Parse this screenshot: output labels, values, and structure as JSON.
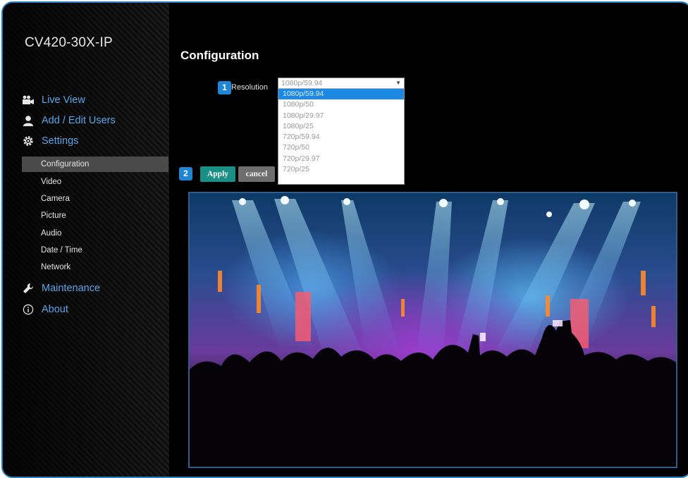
{
  "device": {
    "title": "CV420-30X-IP"
  },
  "nav": {
    "main": [
      {
        "label": "Live View",
        "icon": "video-camera-icon"
      },
      {
        "label": "Add / Edit Users",
        "icon": "user-icon"
      },
      {
        "label": "Settings",
        "icon": "gear-icon"
      },
      {
        "label": "Maintenance",
        "icon": "wrench-icon"
      },
      {
        "label": "About",
        "icon": "info-icon"
      }
    ],
    "settings_sub": [
      "Configuration",
      "Video",
      "Camera",
      "Picture",
      "Audio",
      "Date / Time",
      "Network"
    ],
    "active_sub": "Configuration"
  },
  "content": {
    "title": "Configuration",
    "badges": [
      "1",
      "2"
    ],
    "resolution": {
      "label": "Resolution",
      "selected": "1080p/59.94",
      "options": [
        "1080p/59.94",
        "1080p/50",
        "1080p/29.97",
        "1080p/25",
        "720p/59.94",
        "720p/50",
        "720p/29.97",
        "720p/25"
      ],
      "highlighted": "1080p/59.94"
    },
    "buttons": {
      "apply": "Apply",
      "cancel": "cancel"
    }
  },
  "colors": {
    "accent": "#2b7fc3",
    "nav_link": "#58a6ea",
    "apply": "#1a8f86",
    "highlight": "#1e88e5"
  }
}
